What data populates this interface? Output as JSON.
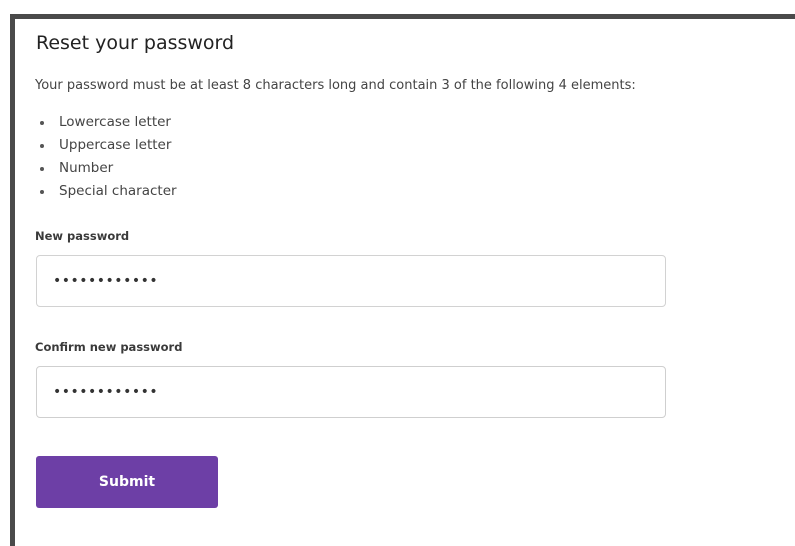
{
  "form": {
    "title": "Reset your password",
    "intro": "Your password must be at least 8 characters long and contain 3 of the following 4 elements:",
    "requirements": [
      "Lowercase letter",
      "Uppercase letter",
      "Number",
      "Special character"
    ],
    "new_password": {
      "label": "New password",
      "value": "••••••••••••"
    },
    "confirm_password": {
      "label": "Confirm new password",
      "value": "••••••••••••"
    },
    "submit_label": "Submit"
  },
  "colors": {
    "accent": "#6d3fa6",
    "frame": "#4a4a4a",
    "input_border": "#d2d2d2"
  }
}
